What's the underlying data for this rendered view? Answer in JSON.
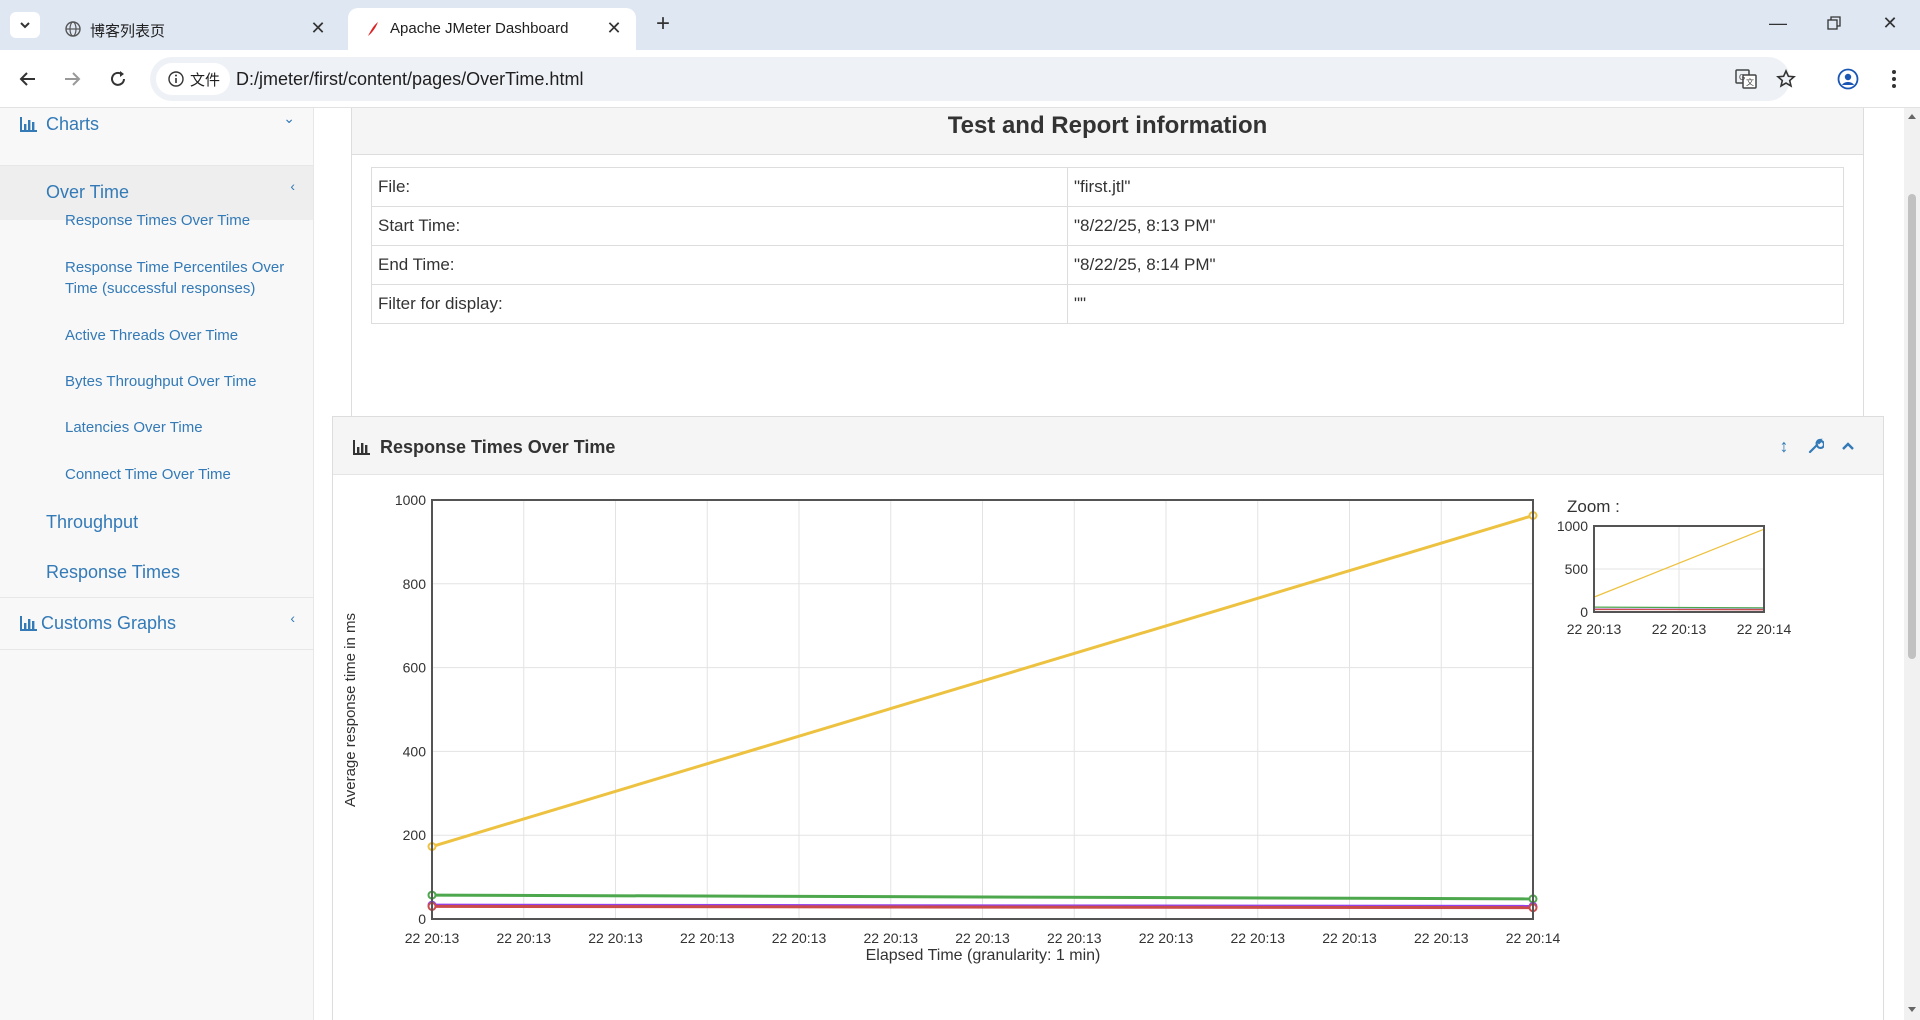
{
  "browser": {
    "tabs": [
      {
        "title": "博客列表页",
        "active": false
      },
      {
        "title": "Apache JMeter Dashboard",
        "active": true
      }
    ],
    "site_chip": "文件",
    "url": "D:/jmeter/first/content/pages/OverTime.html"
  },
  "sidebar": {
    "charts_label": "Charts",
    "over_time_label": "Over Time",
    "sub_items": [
      "Response Times Over Time",
      "Response Time Percentiles Over Time (successful responses)",
      "Active Threads Over Time",
      "Bytes Throughput Over Time",
      "Latencies Over Time",
      "Connect Time Over Time"
    ],
    "throughput_label": "Throughput",
    "response_times_label": "Response Times",
    "customs_label": "Customs Graphs"
  },
  "info": {
    "title": "Test and Report information",
    "rows": [
      {
        "key": "File:",
        "value": "\"first.jtl\""
      },
      {
        "key": "Start Time:",
        "value": "\"8/22/25, 8:13 PM\""
      },
      {
        "key": "End Time:",
        "value": "\"8/22/25, 8:14 PM\""
      },
      {
        "key": "Filter for display:",
        "value": "\"\""
      }
    ]
  },
  "panel": {
    "title": "Response Times Over Time",
    "zoom_label": "Zoom :"
  },
  "chart_data": {
    "type": "line",
    "xlabel": "Elapsed Time (granularity: 1 min)",
    "ylabel": "Average response time in ms",
    "ylim": [
      0,
      1000
    ],
    "yticks": [
      0,
      200,
      400,
      600,
      800,
      1000
    ],
    "xtick_labels": [
      "22 20:13",
      "22 20:13",
      "22 20:13",
      "22 20:13",
      "22 20:13",
      "22 20:13",
      "22 20:13",
      "22 20:13",
      "22 20:13",
      "22 20:13",
      "22 20:13",
      "22 20:13",
      "22 20:14"
    ],
    "grid": true,
    "series": [
      {
        "color": "#edc240",
        "values": [
          173,
          963
        ]
      },
      {
        "color": "#4da74d",
        "values": [
          57,
          48
        ]
      },
      {
        "color": "#9440ed",
        "values": [
          33,
          30
        ]
      },
      {
        "color": "#cb4b4b",
        "values": [
          30,
          27
        ]
      }
    ],
    "zoom": {
      "yticks": [
        0,
        500,
        1000
      ],
      "xtick_labels": [
        "22 20:13",
        "22 20:13",
        "22 20:14"
      ]
    }
  }
}
